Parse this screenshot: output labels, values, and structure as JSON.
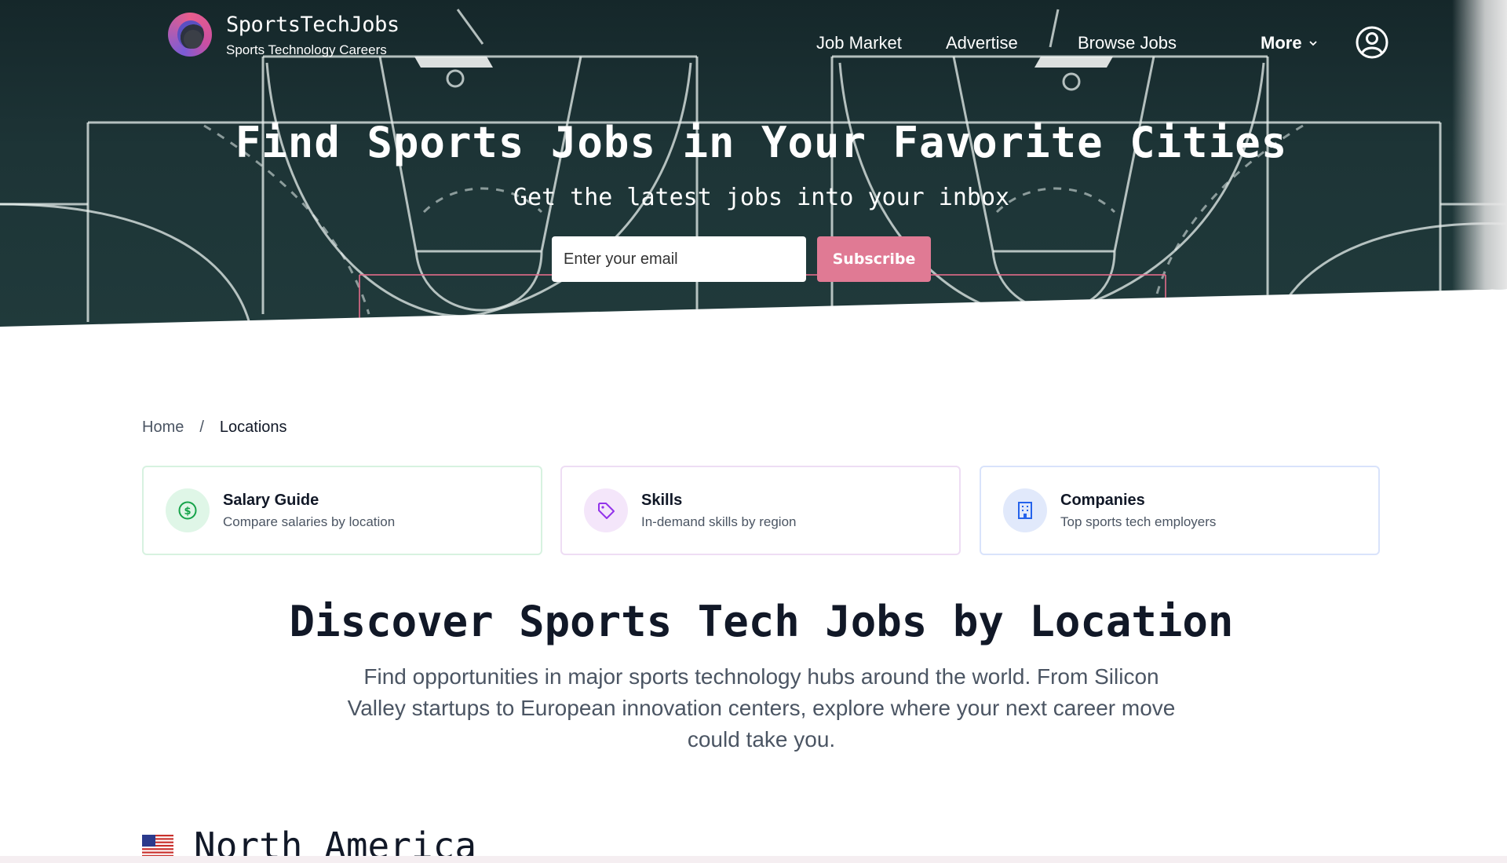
{
  "header": {
    "brand_title": "SportsTechJobs",
    "brand_subtitle": "Sports Technology Careers",
    "nav": [
      "Job Market",
      "Advertise",
      "Browse Jobs"
    ],
    "more_label": "More"
  },
  "hero": {
    "title": "Find Sports Jobs in Your Favorite Cities",
    "subtitle": "Get the latest jobs into your inbox",
    "email_placeholder": "Enter your email",
    "subscribe_label": "Subscribe"
  },
  "breadcrumb": {
    "home": "Home",
    "separator": "/",
    "current": "Locations"
  },
  "cards": [
    {
      "title": "Salary Guide",
      "desc": "Compare salaries by location",
      "icon": "dollar-icon",
      "color": "#16a34a"
    },
    {
      "title": "Skills",
      "desc": "In-demand skills by region",
      "icon": "tag-icon",
      "color": "#9333ea"
    },
    {
      "title": "Companies",
      "desc": "Top sports tech employers",
      "icon": "building-icon",
      "color": "#2563eb"
    }
  ],
  "main": {
    "title": "Discover Sports Tech Jobs by Location",
    "description": "Find opportunities in major sports technology hubs around the world. From Silicon Valley startups to European innovation centers, explore where your next career move could take you."
  },
  "region": {
    "flag": "us-flag-icon",
    "title": "North America"
  },
  "colors": {
    "hero_bg": "#1d3436",
    "subscribe": "#e07a94",
    "text_dark": "#111827",
    "text_muted": "#4b5563"
  }
}
